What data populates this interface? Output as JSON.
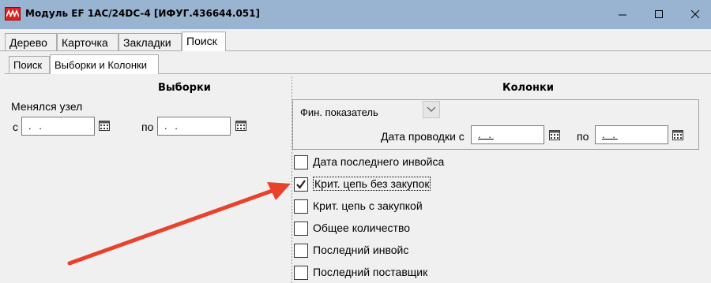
{
  "window": {
    "title": "Модуль EF 1AC/24DC-4 [ИФУГ.436644.051]",
    "app_icon": "app-logo-icon"
  },
  "tabs": [
    {
      "label": "Дерево",
      "active": false
    },
    {
      "label": "Карточка",
      "active": false
    },
    {
      "label": "Закладки",
      "active": false
    },
    {
      "label": "Поиск",
      "active": true
    }
  ],
  "subtabs": [
    {
      "label": "Поиск",
      "active": false
    },
    {
      "label": "Выборки и Колонки",
      "active": true
    }
  ],
  "selections": {
    "header": "Выборки",
    "changed_node_label": "Менялся узел",
    "from_label": "с",
    "from_value": " . .",
    "to_label": "по",
    "to_value": " . ."
  },
  "columns": {
    "header": "Колонки",
    "fin_label": "Фин. показатель",
    "posting_date_label": "Дата проводки с",
    "posting_from_value": ". .",
    "posting_to_label": "по",
    "posting_to_value": ". .",
    "checkboxes": [
      {
        "label": "Дата последнего инвойса",
        "checked": false
      },
      {
        "label": "Крит. цепь без закупок",
        "checked": true
      },
      {
        "label": "Крит. цепь с закупкой",
        "checked": false
      },
      {
        "label": "Общее количество",
        "checked": false
      },
      {
        "label": "Последний инвойс",
        "checked": false
      },
      {
        "label": "Последний поставщик",
        "checked": false
      }
    ]
  },
  "colors": {
    "titlebar": "#99b4d1",
    "arrow": "#e8412c"
  }
}
